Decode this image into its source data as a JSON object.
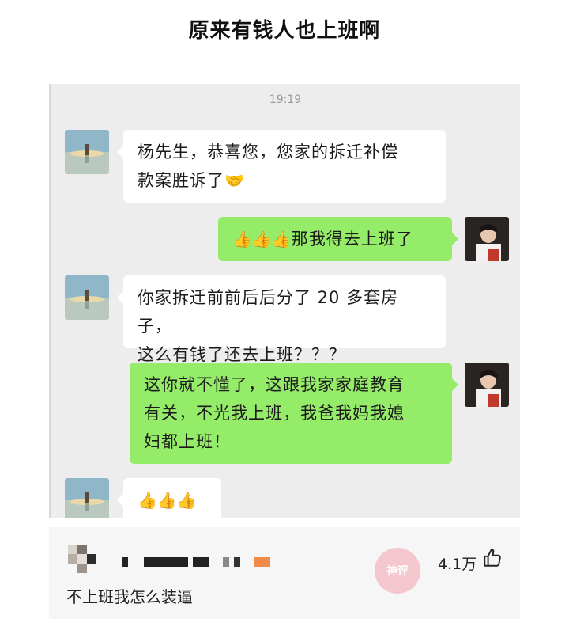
{
  "post": {
    "title": "原来有钱人也上班啊"
  },
  "chat": {
    "time": "19:19",
    "messages": [
      {
        "from": "other",
        "lines": [
          "杨先生，恭喜您，您家的拆迁补偿",
          "款案胜诉了"
        ],
        "emoji": "🤝"
      },
      {
        "from": "me",
        "emoji": "👍👍👍",
        "text": "那我得去上班了"
      },
      {
        "from": "other",
        "lines": [
          "你家拆迁前前后后分了 20 多套房子，",
          "这么有钱了还去上班？？？"
        ]
      },
      {
        "from": "me",
        "lines": [
          "这你就不懂了，这跟我家家庭教育",
          "有关，不光我上班，我爸我妈我媳",
          "妇都上班！"
        ]
      },
      {
        "from": "other",
        "emoji": "👍👍👍"
      }
    ]
  },
  "comment": {
    "likes": "4.1万",
    "text": "不上班我怎么装逼",
    "watermark": "神评"
  },
  "colors": {
    "bubble_in": "#ffffff",
    "bubble_out": "#95ec69",
    "chat_bg": "#ededed"
  },
  "icons": [
    "thumbs-up-icon",
    "handshake-emoji",
    "thumbs-up-emoji"
  ]
}
